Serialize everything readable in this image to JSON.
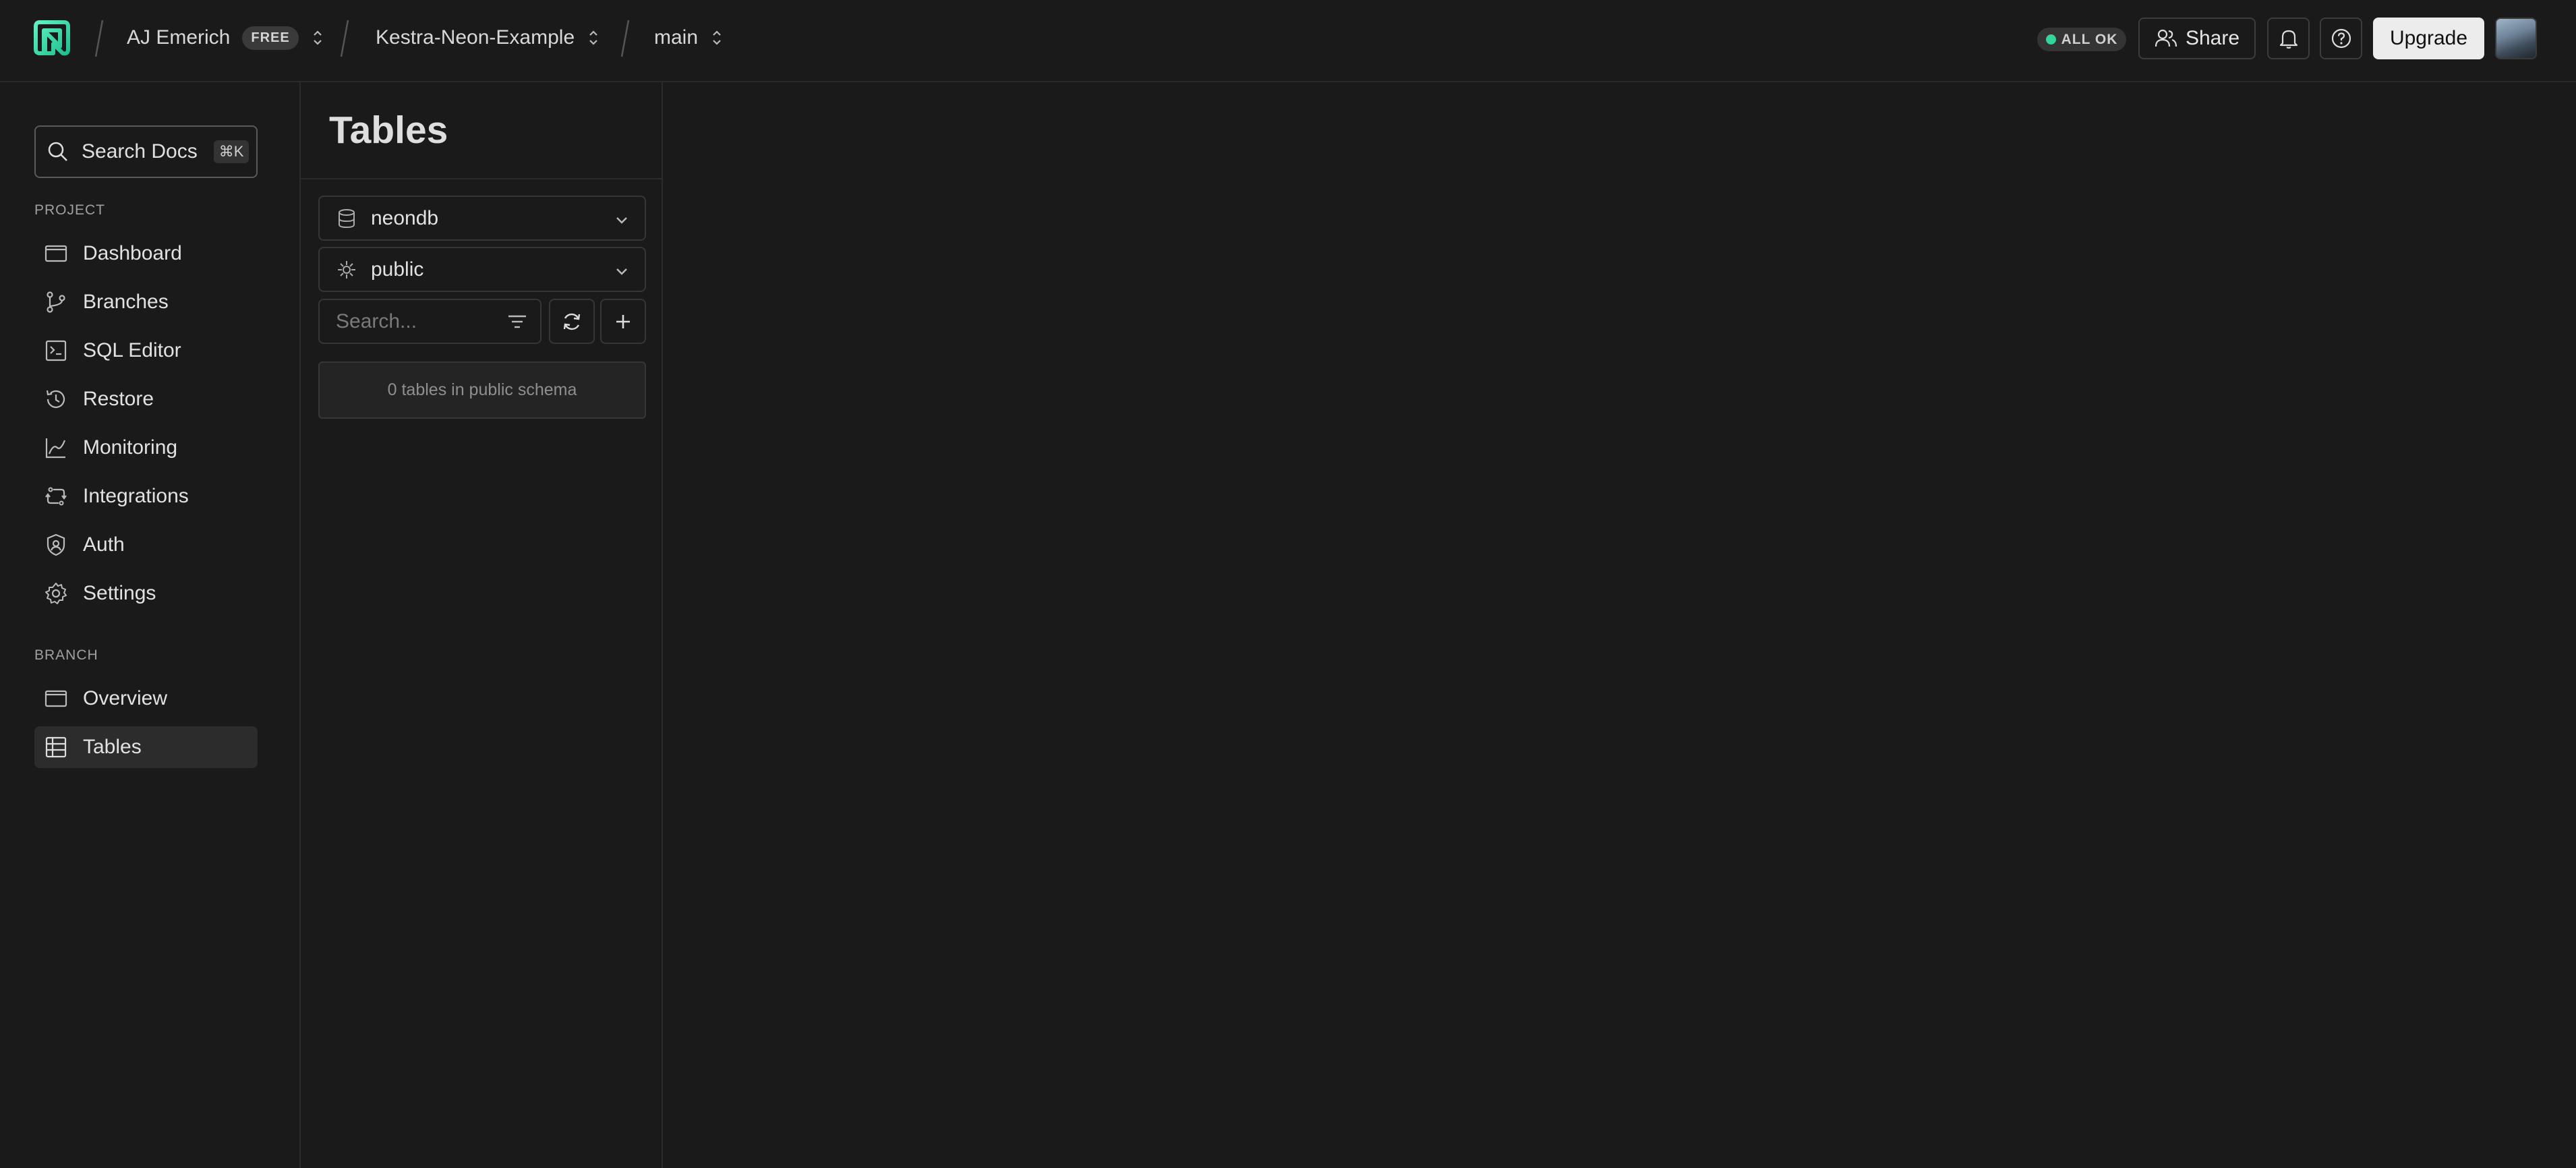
{
  "header": {
    "org_name": "AJ Emerich",
    "plan_badge": "FREE",
    "project_name": "Kestra-Neon-Example",
    "branch_name": "main",
    "status_text": "ALL OK",
    "status_color": "#34d59a",
    "share_label": "Share",
    "upgrade_label": "Upgrade",
    "icons": [
      "neon-logo-icon",
      "bell-icon",
      "help-circle-icon",
      "avatar"
    ]
  },
  "sidebar": {
    "search_label": "Search Docs",
    "search_shortcut": "⌘K",
    "project_section": "PROJECT",
    "project_items": [
      {
        "label": "Dashboard",
        "icon": "dashboard-icon"
      },
      {
        "label": "Branches",
        "icon": "branches-icon"
      },
      {
        "label": "SQL Editor",
        "icon": "sql-editor-icon"
      },
      {
        "label": "Restore",
        "icon": "restore-icon"
      },
      {
        "label": "Monitoring",
        "icon": "monitoring-icon"
      },
      {
        "label": "Integrations",
        "icon": "integrations-icon"
      },
      {
        "label": "Auth",
        "icon": "auth-icon"
      },
      {
        "label": "Settings",
        "icon": "settings-icon"
      }
    ],
    "branch_section": "BRANCH",
    "branch_items": [
      {
        "label": "Overview",
        "icon": "overview-icon"
      },
      {
        "label": "Tables",
        "icon": "tables-icon",
        "active": true
      }
    ]
  },
  "tables_panel": {
    "title": "Tables",
    "database": "neondb",
    "schema": "public",
    "search_placeholder": "Search...",
    "empty_message": "0 tables in public schema"
  }
}
